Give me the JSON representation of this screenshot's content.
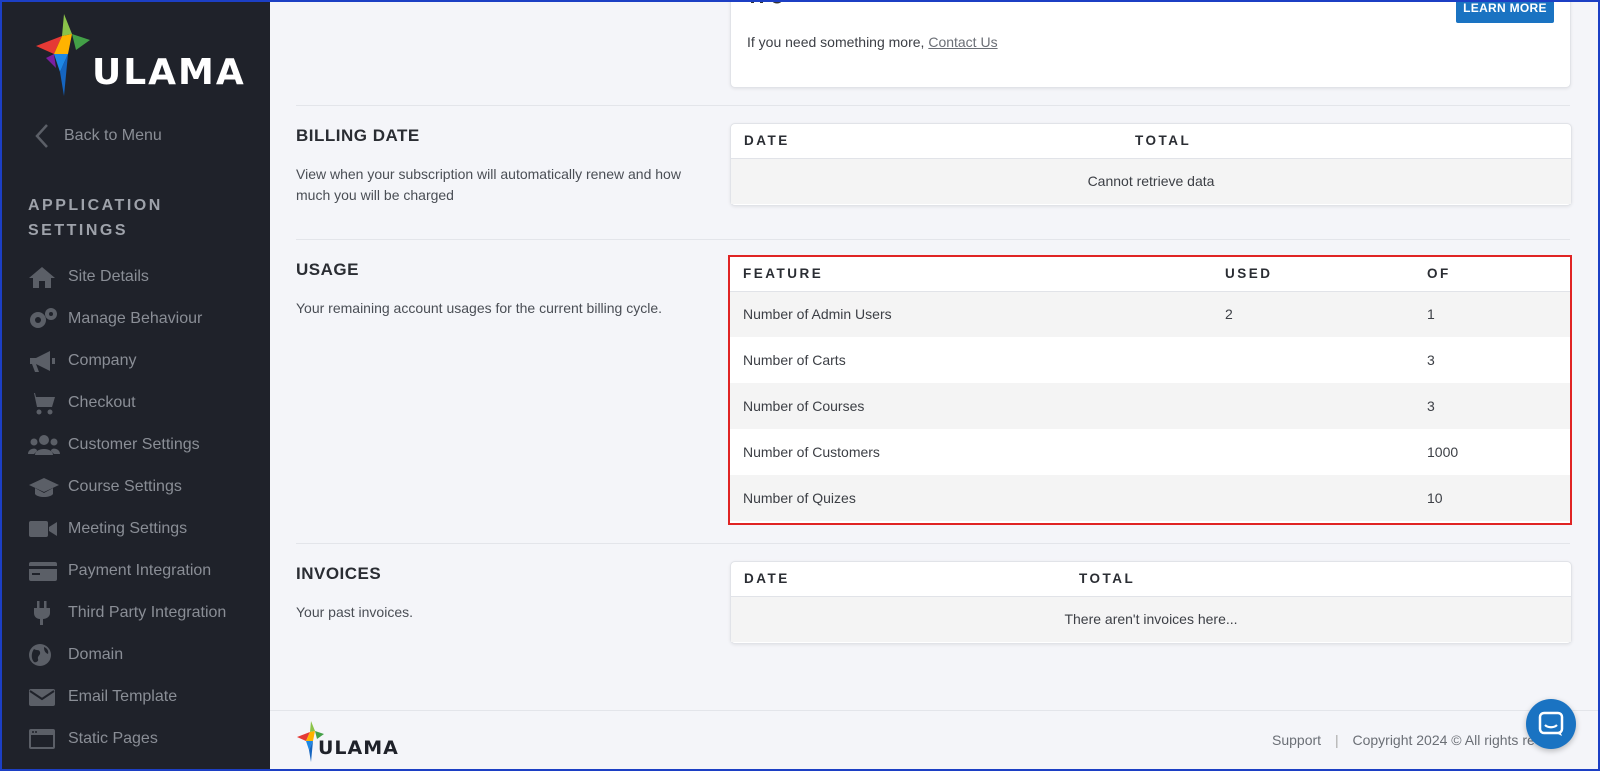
{
  "brand": {
    "name": "ULAMA"
  },
  "sidebar": {
    "back_label": "Back to Menu",
    "section_title": "APPLICATION SETTINGS",
    "items": [
      {
        "label": "Site Details",
        "icon": "home-icon"
      },
      {
        "label": "Manage Behaviour",
        "icon": "gears-icon"
      },
      {
        "label": "Company",
        "icon": "megaphone-icon"
      },
      {
        "label": "Checkout",
        "icon": "cart-icon"
      },
      {
        "label": "Customer Settings",
        "icon": "users-icon"
      },
      {
        "label": "Course Settings",
        "icon": "graduation-cap-icon"
      },
      {
        "label": "Meeting Settings",
        "icon": "video-icon"
      },
      {
        "label": "Payment Integration",
        "icon": "credit-card-icon"
      },
      {
        "label": "Third Party Integration",
        "icon": "plug-icon"
      },
      {
        "label": "Domain",
        "icon": "globe-icon"
      },
      {
        "label": "Email Template",
        "icon": "envelope-icon"
      },
      {
        "label": "Static Pages",
        "icon": "window-icon"
      }
    ]
  },
  "plan": {
    "note_prefix": "If you need something more,",
    "contact_link": "Contact Us",
    "learn_more": "LEARN MORE"
  },
  "billing": {
    "title": "BILLING DATE",
    "description": "View when your subscription will automatically renew and how much you will be charged",
    "columns": [
      "DATE",
      "TOTAL"
    ],
    "empty_text": "Cannot retrieve data"
  },
  "usage": {
    "title": "USAGE",
    "description": "Your remaining account usages for the current billing cycle.",
    "columns": [
      "FEATURE",
      "USED",
      "OF"
    ],
    "rows": [
      {
        "feature": "Number of Admin Users",
        "used": "2",
        "of": "1"
      },
      {
        "feature": "Number of Carts",
        "used": "",
        "of": "3"
      },
      {
        "feature": "Number of Courses",
        "used": "",
        "of": "3"
      },
      {
        "feature": "Number of Customers",
        "used": "",
        "of": "1000"
      },
      {
        "feature": "Number of Quizes",
        "used": "",
        "of": "10"
      }
    ]
  },
  "invoices": {
    "title": "INVOICES",
    "description": "Your past invoices.",
    "columns": [
      "DATE",
      "TOTAL"
    ],
    "empty_text": "There aren't invoices here..."
  },
  "footer": {
    "support": "Support",
    "separator": "|",
    "copyright": "Copyright 2024 © All rights re"
  },
  "colors": {
    "accent": "#1a73c2",
    "sidebar_bg": "#1f222a",
    "highlight": "#e02424"
  }
}
